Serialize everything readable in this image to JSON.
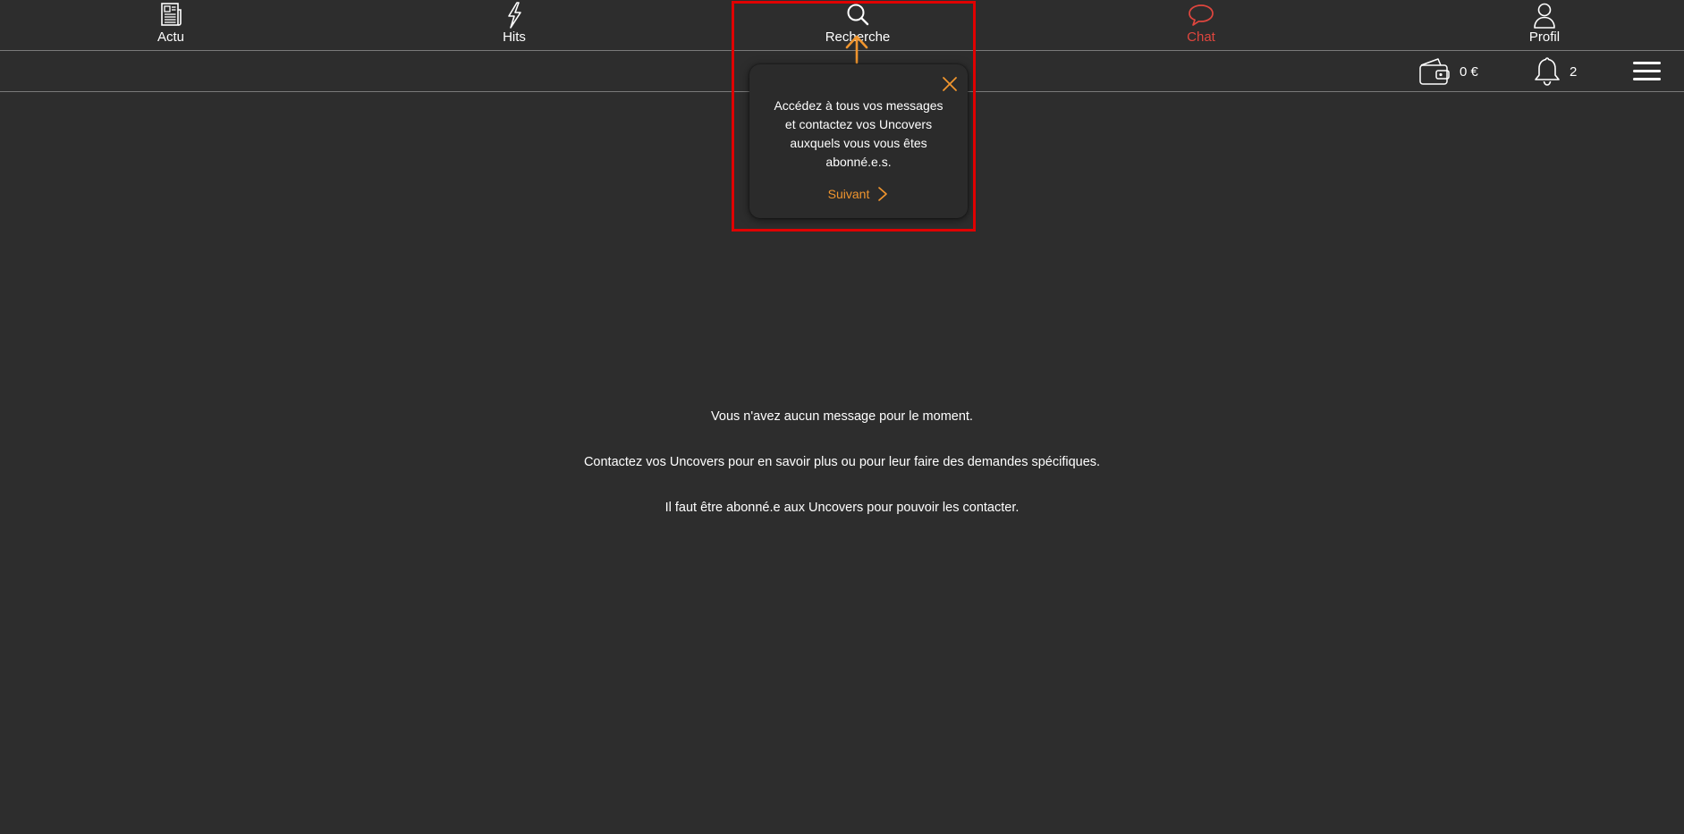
{
  "nav": {
    "items": [
      {
        "label": "Actu",
        "icon": "newspaper-icon"
      },
      {
        "label": "Hits",
        "icon": "lightning-icon"
      },
      {
        "label": "Recherche",
        "icon": "search-icon"
      },
      {
        "label": "Chat",
        "icon": "chat-bubble-icon",
        "active": true
      },
      {
        "label": "Profil",
        "icon": "user-icon"
      }
    ]
  },
  "toolbar": {
    "wallet_amount": "0 €",
    "notification_count": "2"
  },
  "tour": {
    "text": "Accédez à tous vos messages et contactez vos Uncovers auxquels vous vous êtes abonné.e.s.",
    "next_label": "Suivant"
  },
  "empty_state": {
    "line1": "Vous n'avez aucun message pour le moment.",
    "line2": "Contactez vos Uncovers pour en savoir plus ou pour leur faire des demandes spécifiques.",
    "line3": "Il faut être abonné.e aux Uncovers pour pouvoir les contacter."
  },
  "colors": {
    "background": "#2d2d2d",
    "active": "#e0463e",
    "accent": "#f0952e",
    "highlight": "#e00000"
  }
}
